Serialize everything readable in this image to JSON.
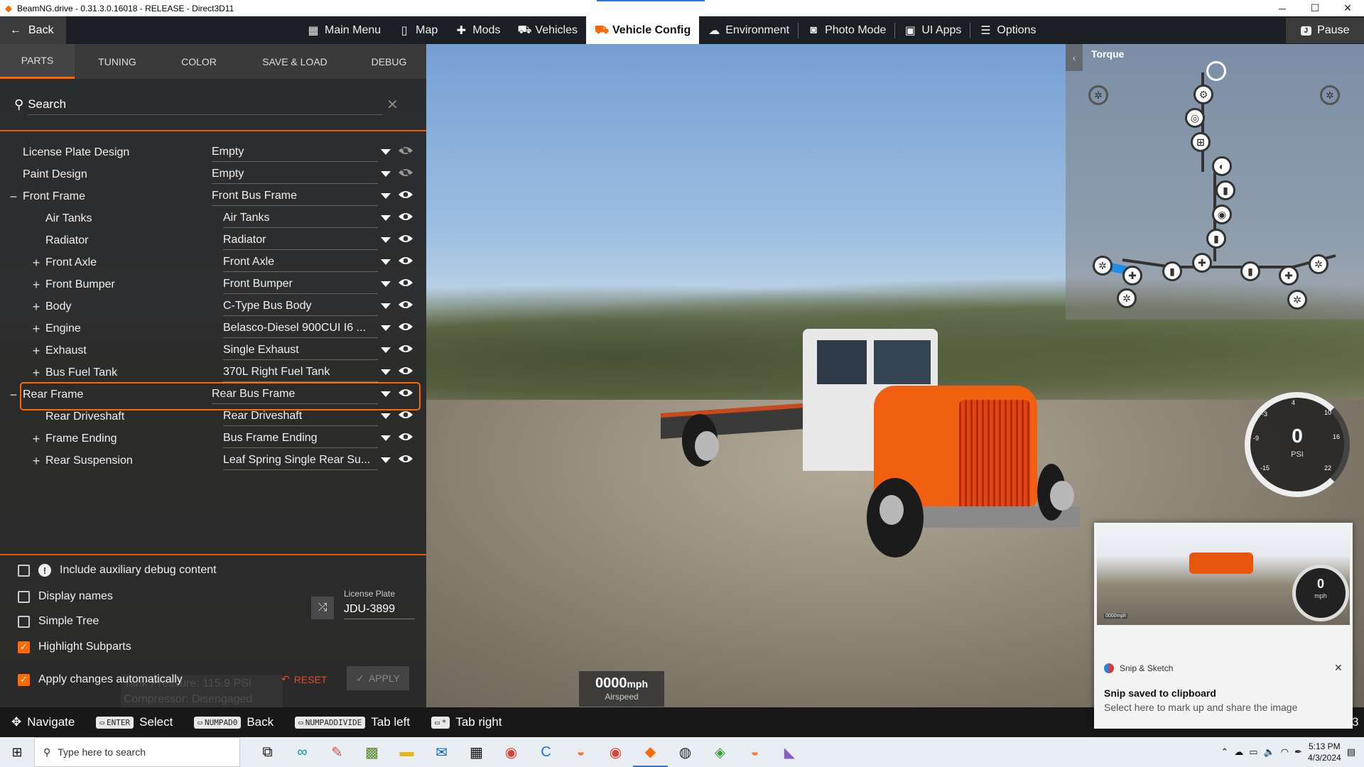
{
  "window": {
    "title": "BeamNG.drive - 0.31.3.0.16018 - RELEASE - Direct3D11",
    "minimize_icon": "minimize-icon",
    "maximize_icon": "maximize-icon",
    "close_icon": "close-icon"
  },
  "topnav": {
    "back_label": "Back",
    "items": [
      {
        "label": "Main Menu",
        "icon": "grid-icon"
      },
      {
        "label": "Map",
        "icon": "map-icon"
      },
      {
        "label": "Mods",
        "icon": "puzzle-icon"
      },
      {
        "label": "Vehicles",
        "icon": "car-icon"
      },
      {
        "label": "Vehicle Config",
        "icon": "wrench-car-icon",
        "active": true
      },
      {
        "label": "Environment",
        "icon": "weather-icon"
      },
      {
        "label": "Photo Mode",
        "icon": "camera-icon"
      },
      {
        "label": "UI Apps",
        "icon": "apps-icon"
      },
      {
        "label": "Options",
        "icon": "sliders-icon"
      }
    ],
    "pause_key": "J",
    "pause_label": "Pause"
  },
  "panel": {
    "tabs": [
      "Parts",
      "Tuning",
      "Color",
      "Save & Load",
      "Debug"
    ],
    "active_tab": "Parts",
    "search_placeholder": "Search",
    "parts": [
      {
        "name": "License Plate Design",
        "value": "Empty",
        "level": 0,
        "expander": "",
        "hidden": true
      },
      {
        "name": "Paint Design",
        "value": "Empty",
        "level": 0,
        "expander": "",
        "hidden": true
      },
      {
        "name": "Front Frame",
        "value": "Front Bus Frame",
        "level": 0,
        "expander": "−",
        "hidden": false
      },
      {
        "name": "Air Tanks",
        "value": "Air Tanks",
        "level": 1,
        "expander": "",
        "hidden": false
      },
      {
        "name": "Radiator",
        "value": "Radiator",
        "level": 1,
        "expander": "",
        "hidden": false
      },
      {
        "name": "Front Axle",
        "value": "Front Axle",
        "level": 1,
        "expander": "+",
        "hidden": false
      },
      {
        "name": "Front Bumper",
        "value": "Front Bumper",
        "level": 1,
        "expander": "+",
        "hidden": false
      },
      {
        "name": "Body",
        "value": "C-Type Bus Body",
        "level": 1,
        "expander": "+",
        "hidden": false
      },
      {
        "name": "Engine",
        "value": "Belasco-Diesel 900CUI I6 ...",
        "level": 1,
        "expander": "+",
        "hidden": false
      },
      {
        "name": "Exhaust",
        "value": "Single Exhaust",
        "level": 1,
        "expander": "+",
        "hidden": false
      },
      {
        "name": "Bus Fuel Tank",
        "value": "370L Right Fuel Tank",
        "level": 1,
        "expander": "+",
        "hidden": false
      },
      {
        "name": "Rear Frame",
        "value": "Rear Bus Frame",
        "level": 0,
        "expander": "−",
        "hidden": false,
        "selected": true
      },
      {
        "name": "Rear Driveshaft",
        "value": "Rear Driveshaft",
        "level": 1,
        "expander": "",
        "hidden": false
      },
      {
        "name": "Frame Ending",
        "value": "Bus Frame Ending",
        "level": 1,
        "expander": "+",
        "hidden": false
      },
      {
        "name": "Rear Suspension",
        "value": "Leaf Spring Single Rear Su...",
        "level": 1,
        "expander": "+",
        "hidden": false
      }
    ],
    "options": {
      "aux_debug": {
        "label": "Include auxiliary debug content",
        "checked": false
      },
      "display_names": {
        "label": "Display names",
        "checked": false
      },
      "simple_tree": {
        "label": "Simple Tree",
        "checked": false
      },
      "highlight_subparts": {
        "label": "Highlight Subparts",
        "checked": true
      },
      "apply_auto": {
        "label": "Apply changes automatically",
        "checked": true
      }
    },
    "license_plate_label": "License Plate",
    "license_plate_value": "JDU-3899",
    "reset_label": "RESET",
    "apply_label": "APPLY",
    "ghost_line1": "Tank Pressure: 115.9 PSI",
    "ghost_line2": "Compressor: Disengaged"
  },
  "hints": [
    {
      "key": "",
      "label": "Navigate",
      "icon": "dpad-icon"
    },
    {
      "key": "ENTER",
      "label": "Select"
    },
    {
      "key": "NUMPAD0",
      "label": "Back"
    },
    {
      "key": "NUMPADDIVIDE",
      "label": "Tab left"
    },
    {
      "key": "*",
      "label": "Tab right"
    }
  ],
  "hint_trailing": "3",
  "powertrain": {
    "title": "Torque"
  },
  "gauge": {
    "value": "0",
    "unit": "PSI",
    "ticks": [
      "-3",
      "4",
      "10",
      "-9",
      "16",
      "-15",
      "22"
    ]
  },
  "airspeed": {
    "value": "0000",
    "unit": "mph",
    "label": "Airspeed"
  },
  "toast": {
    "app": "Snip & Sketch",
    "heading": "Snip saved to clipboard",
    "body": "Select here to mark up and share the image",
    "thumb_speed": "0000mph",
    "thumb_gauge_value": "0",
    "thumb_gauge_unit": "mph"
  },
  "taskbar": {
    "search_placeholder": "Type here to search",
    "time": "5:13 PM",
    "date": "4/3/2024"
  }
}
